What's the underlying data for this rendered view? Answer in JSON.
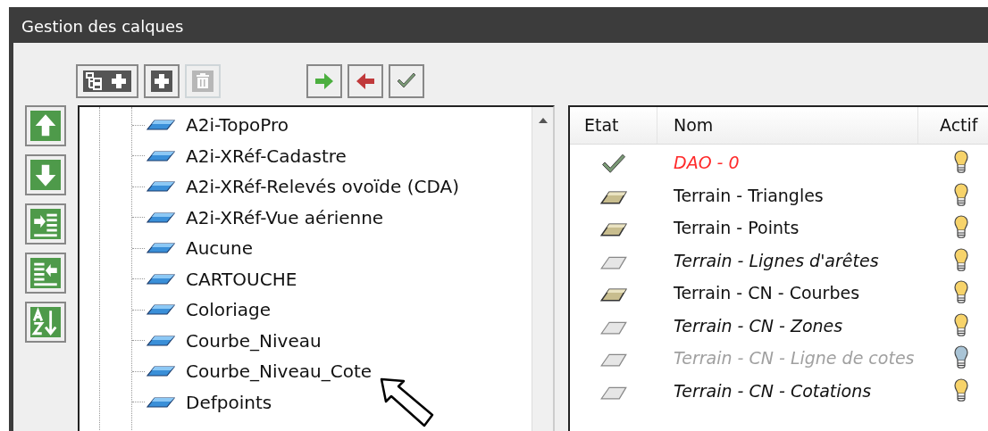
{
  "window": {
    "title": "Gestion des calques"
  },
  "toolbar": [
    {
      "kind": "tree-add",
      "disabled": false
    },
    {
      "kind": "add",
      "disabled": false
    },
    {
      "kind": "delete",
      "disabled": true
    },
    {
      "kind": "move-right",
      "disabled": false
    },
    {
      "kind": "move-left",
      "disabled": false
    },
    {
      "kind": "apply",
      "disabled": false
    }
  ],
  "side_buttons": [
    {
      "kind": "up"
    },
    {
      "kind": "down"
    },
    {
      "kind": "indent"
    },
    {
      "kind": "outdent"
    },
    {
      "kind": "sort"
    }
  ],
  "tree": {
    "items": [
      {
        "label": "A2i-TopoPro"
      },
      {
        "label": "A2i-XRéf-Cadastre"
      },
      {
        "label": "A2i-XRéf-Relevés ovoïde (CDA)"
      },
      {
        "label": "A2i-XRéf-Vue aérienne"
      },
      {
        "label": "Aucune"
      },
      {
        "label": "CARTOUCHE"
      },
      {
        "label": "Coloriage"
      },
      {
        "label": "Courbe_Niveau"
      },
      {
        "label": "Courbe_Niveau_Cote"
      },
      {
        "label": "Defpoints"
      }
    ]
  },
  "layers": {
    "columns": [
      "Etat",
      "Nom",
      "Actif"
    ],
    "rows": [
      {
        "kind": "current",
        "name": "DAO - 0",
        "italic": true,
        "disabled": false,
        "on": true
      },
      {
        "kind": "used",
        "name": "Terrain - Triangles",
        "italic": false,
        "disabled": false,
        "on": true
      },
      {
        "kind": "used",
        "name": "Terrain - Points",
        "italic": false,
        "disabled": false,
        "on": true
      },
      {
        "kind": "empty",
        "name": "Terrain - Lignes d'arêtes",
        "italic": true,
        "disabled": false,
        "on": true
      },
      {
        "kind": "used",
        "name": "Terrain - CN - Courbes",
        "italic": false,
        "disabled": false,
        "on": true
      },
      {
        "kind": "empty",
        "name": "Terrain - CN - Zones",
        "italic": true,
        "disabled": false,
        "on": true
      },
      {
        "kind": "empty",
        "name": "Terrain - CN - Ligne de cotes",
        "italic": true,
        "disabled": true,
        "on": false
      },
      {
        "kind": "empty",
        "name": "Terrain - CN - Cotations",
        "italic": true,
        "disabled": false,
        "on": true
      }
    ]
  }
}
